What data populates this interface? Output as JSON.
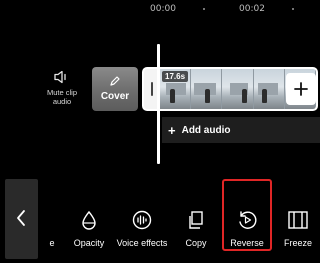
{
  "ruler": {
    "times": [
      "00:00",
      "00:02"
    ]
  },
  "mute": {
    "label": "Mute clip audio"
  },
  "cover": {
    "label": "Cover"
  },
  "clip": {
    "duration": "17.6s"
  },
  "audio": {
    "add_label": "Add audio"
  },
  "toolbar": {
    "tools": [
      {
        "label": "e",
        "icon": "partial-icon"
      },
      {
        "label": "Opacity",
        "icon": "droplet-icon"
      },
      {
        "label": "Voice effects",
        "icon": "voice-wave-icon"
      },
      {
        "label": "Copy",
        "icon": "copy-icon"
      },
      {
        "label": "Reverse",
        "icon": "reverse-icon",
        "selected": true
      },
      {
        "label": "Freeze",
        "icon": "freeze-icon"
      }
    ]
  },
  "colors": {
    "background": "#000000",
    "highlight": "#e02626"
  }
}
